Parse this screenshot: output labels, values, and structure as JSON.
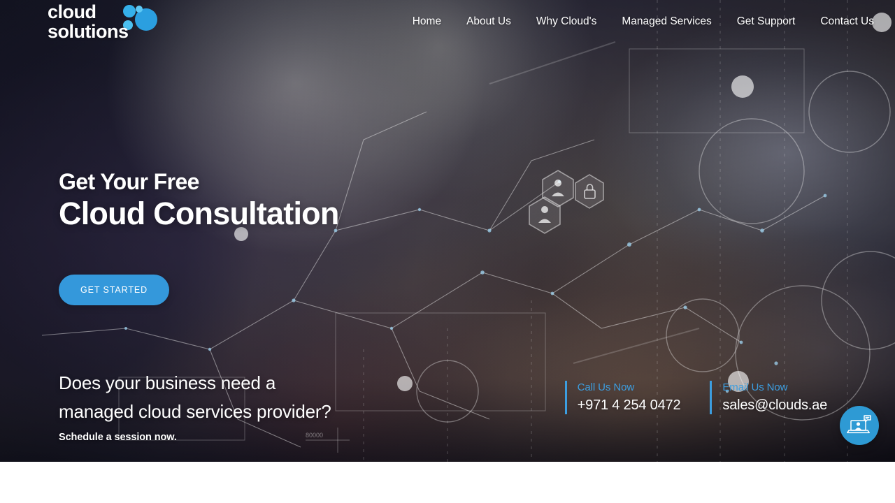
{
  "site": {
    "logo": {
      "line1": "cloud",
      "line2": "solutions",
      "icon": "cloud-bubbles-icon"
    }
  },
  "nav": {
    "items": [
      {
        "label": "Home"
      },
      {
        "label": "About Us"
      },
      {
        "label": "Why Cloud's"
      },
      {
        "label": "Managed Services"
      },
      {
        "label": "Get Support"
      },
      {
        "label": "Contact Us"
      }
    ]
  },
  "hero": {
    "headline_small": "Get Your Free",
    "headline_large": "Cloud Consultation",
    "cta_label": "GET STARTED"
  },
  "lower": {
    "question_line1": "Does your business need a",
    "question_line2": "managed cloud services provider?",
    "subtext": "Schedule a session now.",
    "contacts": [
      {
        "label": "Call Us Now",
        "value": "+971 4 254 0472",
        "icon": "phone-icon"
      },
      {
        "label": "Email Us Now",
        "value": "sales@clouds.ae",
        "icon": "mail-icon"
      }
    ]
  },
  "widgets": {
    "chat_support": {
      "icon": "laptop-support-chat-icon",
      "aria": "Live Support"
    }
  },
  "colors": {
    "accent_blue": "#3498db",
    "contact_blue": "#3c9ee0",
    "widget_blue": "#2e9ad4",
    "text_white": "#ffffff"
  },
  "overlay_text": {
    "grid_number": "80000"
  }
}
